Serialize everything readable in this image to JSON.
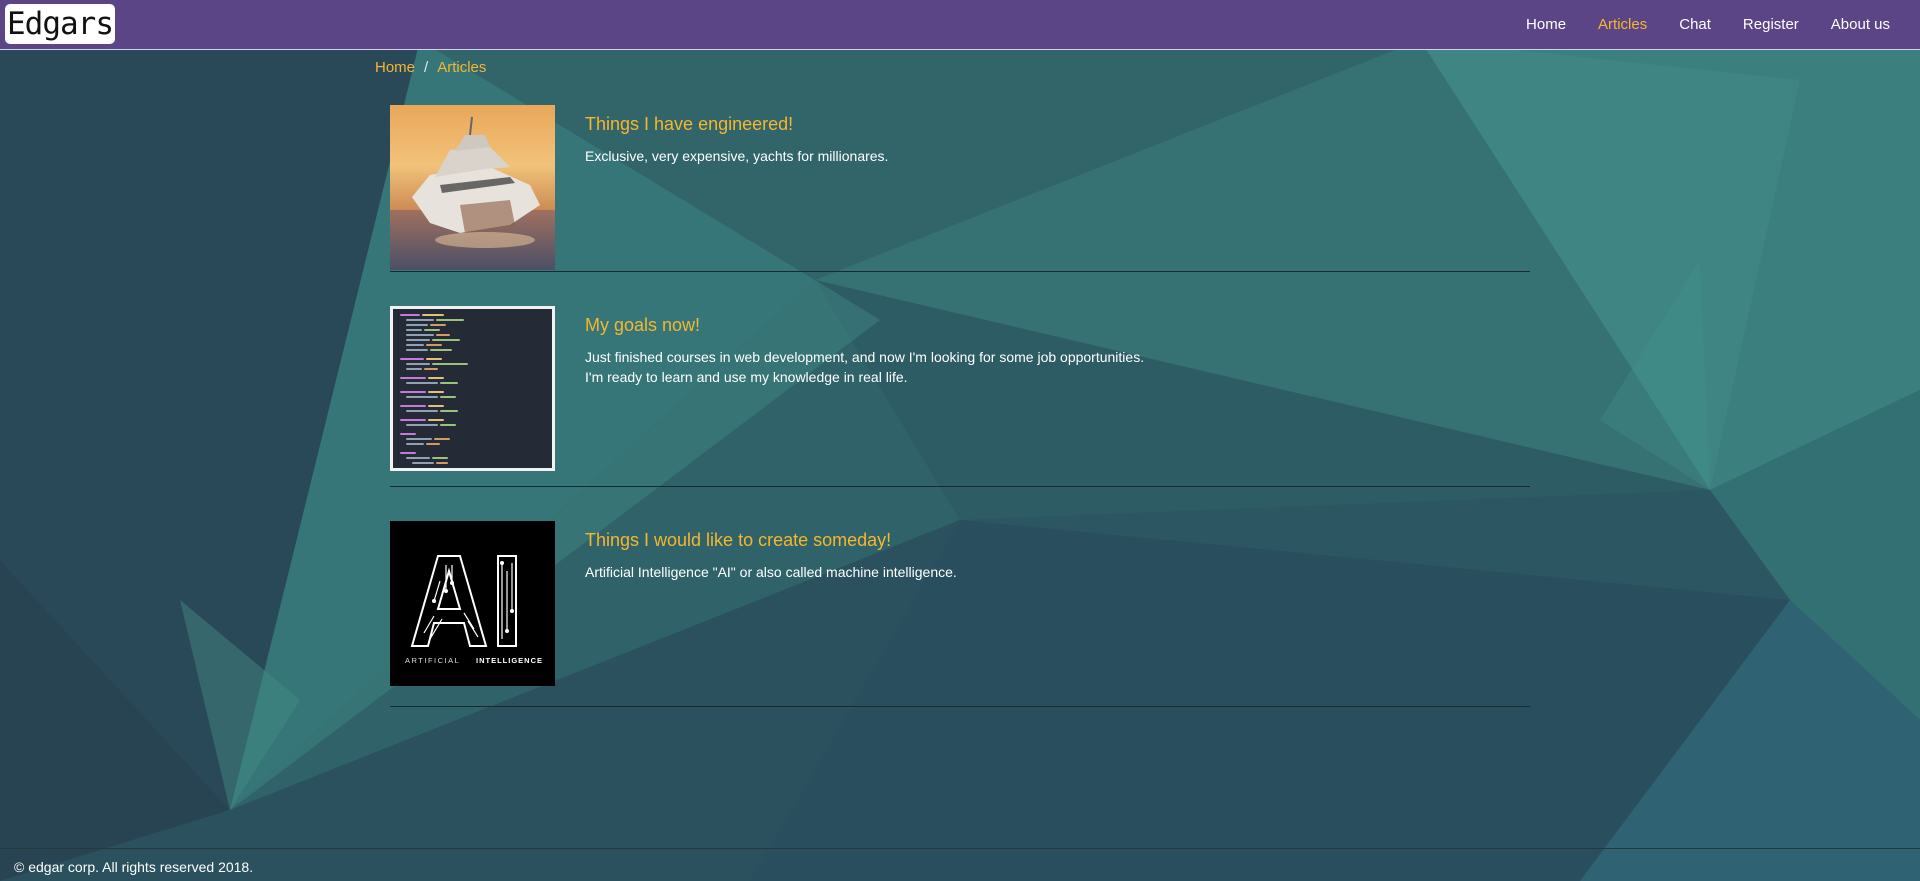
{
  "header": {
    "logo_text": "Edgars",
    "nav": [
      {
        "label": "Home"
      },
      {
        "label": "Articles"
      },
      {
        "label": "Chat"
      },
      {
        "label": "Register"
      },
      {
        "label": "About us"
      }
    ],
    "active_nav": "Articles"
  },
  "breadcrumb": {
    "items": [
      "Home",
      "Articles"
    ],
    "separator": "/"
  },
  "articles": [
    {
      "title": "Things I have engineered!",
      "description_lines": [
        "Exclusive, very expensive, yachts for millionares."
      ],
      "image": "yacht-image"
    },
    {
      "title": "My goals now!",
      "description_lines": [
        "Just finished courses in web development, and now I'm looking for some job opportunities.",
        "I'm ready to learn and use my knowledge in real life."
      ],
      "image": "code-screenshot-image"
    },
    {
      "title": "Things I would like to create someday!",
      "description_lines": [
        "Artificial Intelligence \"AI\" or also called machine intelligence."
      ],
      "image": "ai-logo-image",
      "image_text": {
        "big": "AI",
        "left_word": "ARTIFICIAL",
        "right_word": "INTELLIGENCE"
      }
    }
  ],
  "footer": {
    "text": "© edgar corp. All rights reserved 2018."
  },
  "colors": {
    "navbar": "#5b4587",
    "accent": "#f5b630",
    "background": "#2d5a63",
    "text": "#ffffff"
  }
}
